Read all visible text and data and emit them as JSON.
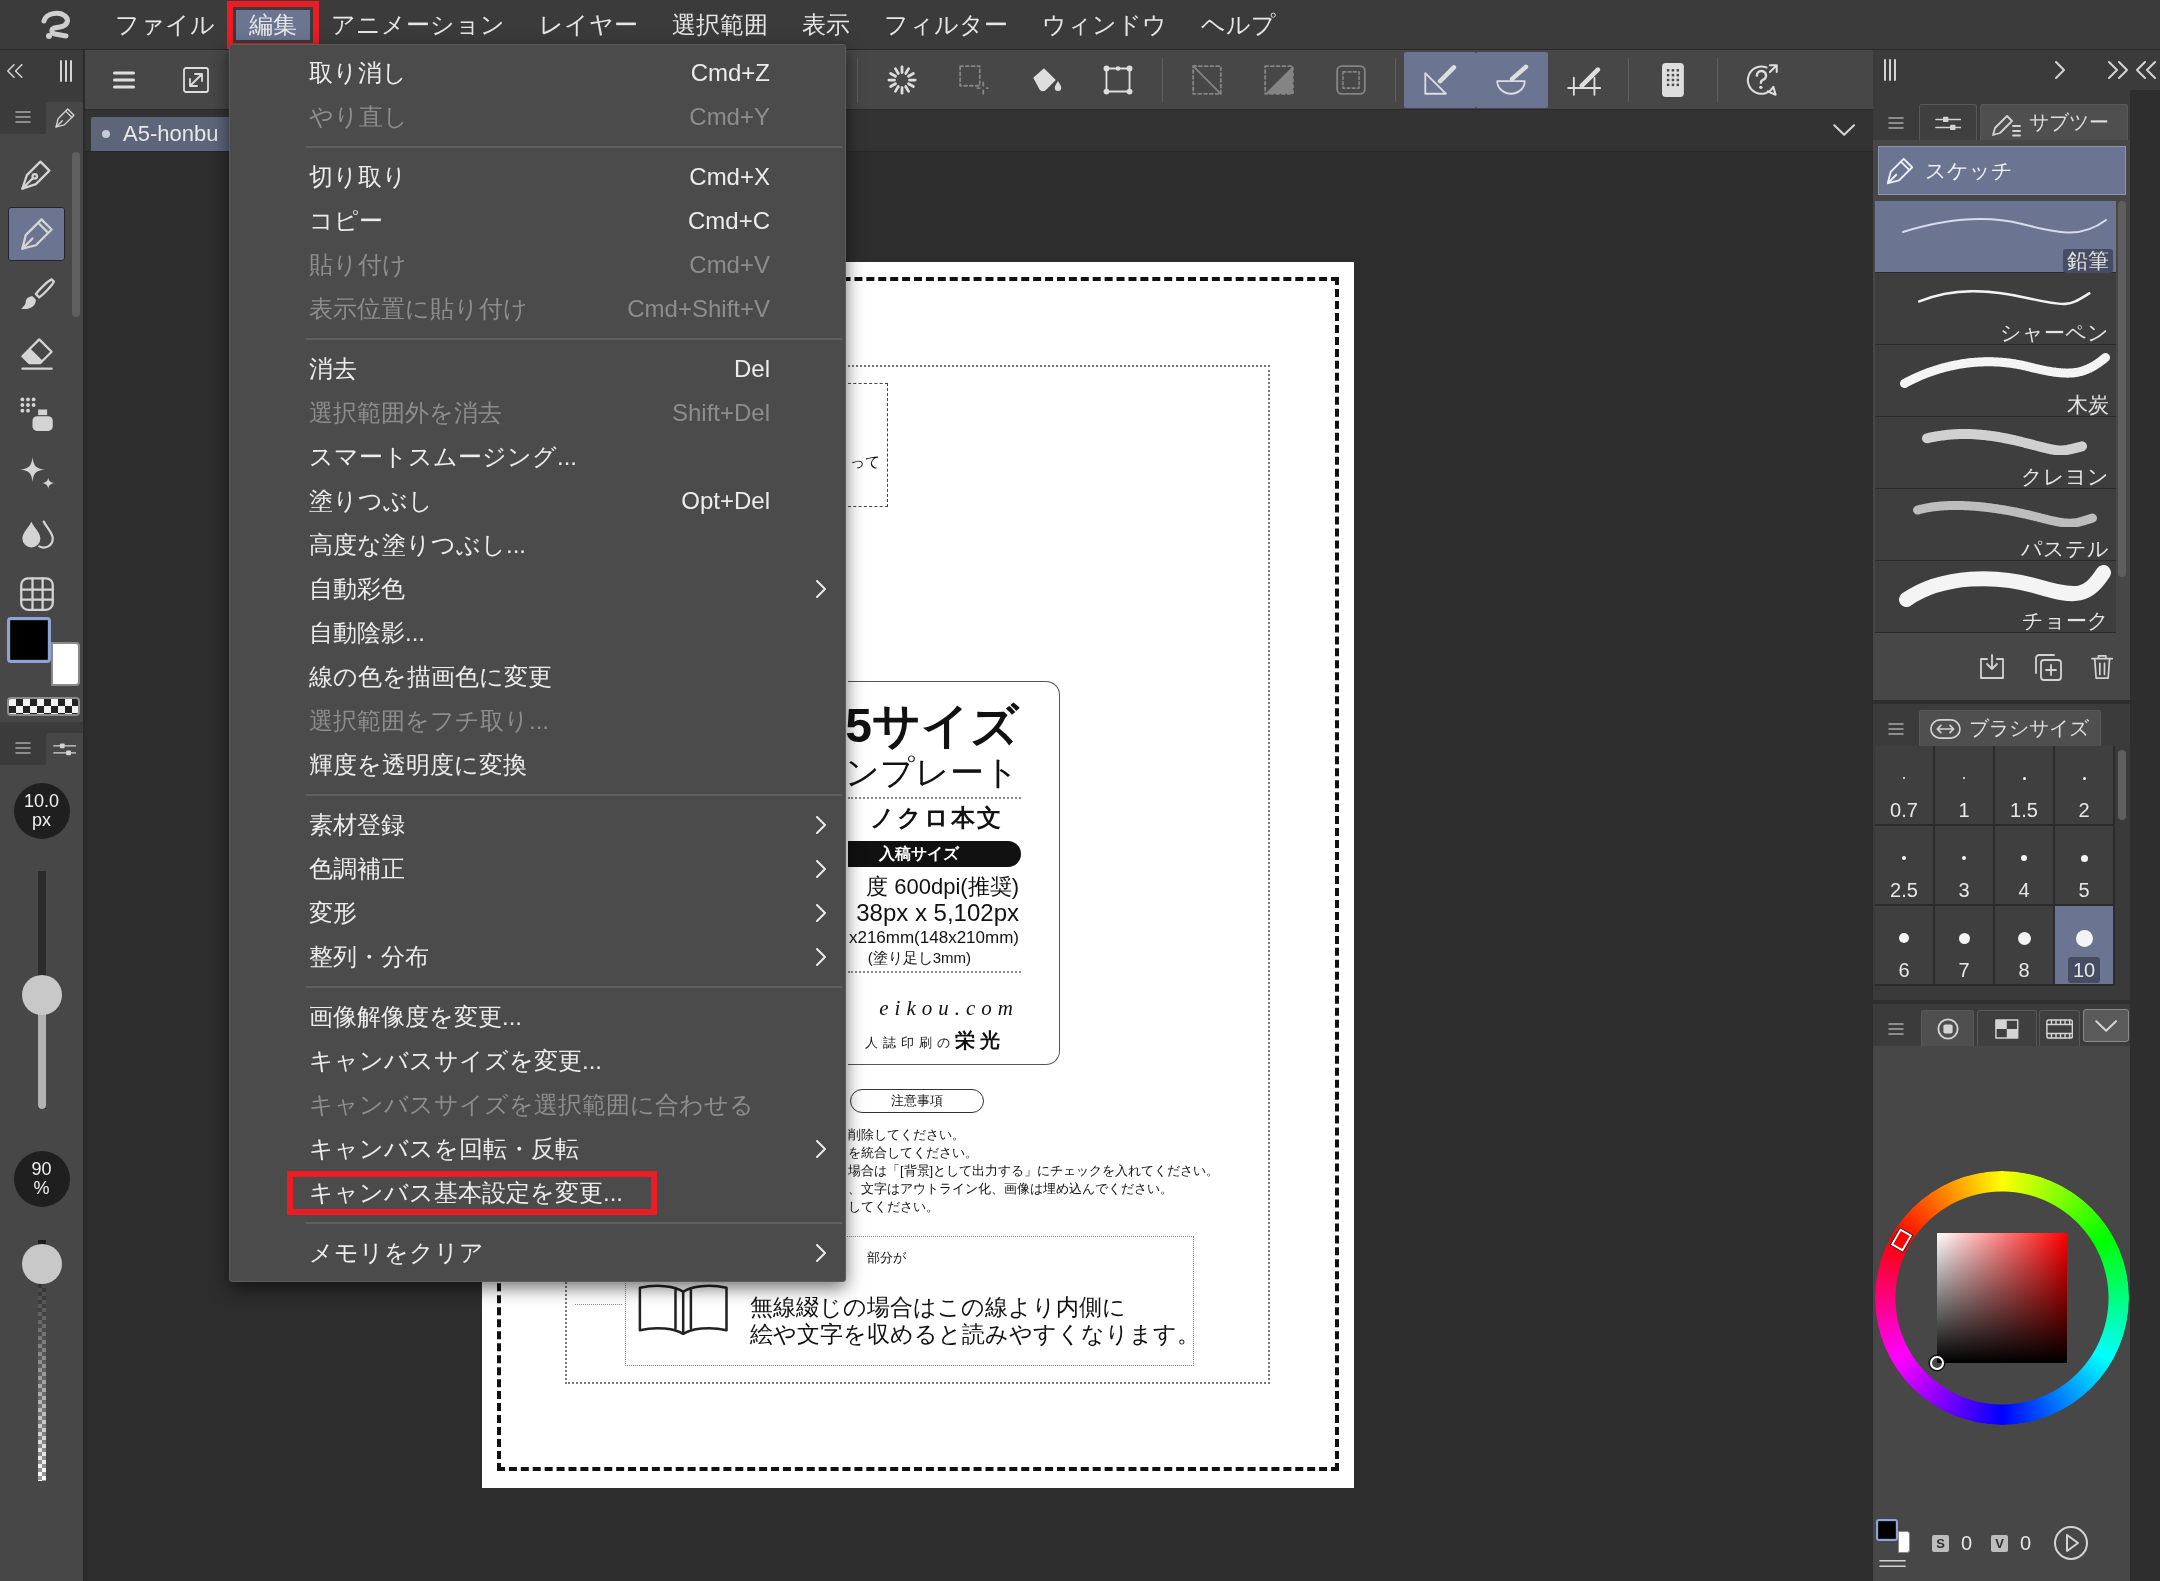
{
  "menu_bar": {
    "items": [
      {
        "label": "ファイル",
        "selected": false,
        "annotated": false
      },
      {
        "label": "編集",
        "selected": true,
        "annotated": true
      },
      {
        "label": "アニメーション",
        "selected": false,
        "annotated": false
      },
      {
        "label": "レイヤー",
        "selected": false,
        "annotated": false
      },
      {
        "label": "選択範囲",
        "selected": false,
        "annotated": false
      },
      {
        "label": "表示",
        "selected": false,
        "annotated": false
      },
      {
        "label": "フィルター",
        "selected": false,
        "annotated": false
      },
      {
        "label": "ウィンドウ",
        "selected": false,
        "annotated": false
      },
      {
        "label": "ヘルプ",
        "selected": false,
        "annotated": false
      }
    ]
  },
  "toolbar": {
    "left_buttons": [
      {
        "selected": false,
        "disabled": false
      },
      {
        "selected": false,
        "disabled": false
      }
    ],
    "groups": [
      [
        {
          "selected": false,
          "disabled": false
        },
        {
          "selected": false,
          "disabled": true
        },
        {
          "selected": false,
          "disabled": false
        },
        {
          "selected": false,
          "disabled": false
        }
      ],
      [
        {
          "selected": false,
          "disabled": true
        },
        {
          "selected": false,
          "disabled": true
        },
        {
          "selected": false,
          "disabled": true
        }
      ],
      [
        {
          "selected": true,
          "disabled": false
        },
        {
          "selected": true,
          "disabled": false
        },
        {
          "selected": false,
          "disabled": false
        }
      ],
      [
        {
          "selected": false,
          "disabled": false
        }
      ],
      [
        {
          "selected": false,
          "disabled": false
        }
      ]
    ]
  },
  "document_tabs": [
    {
      "title": "A5-honbu",
      "selected": true
    }
  ],
  "edit_menu": {
    "groups": [
      {
        "items": [
          {
            "label": "取り消し",
            "shortcut": "Cmd+Z",
            "disabled": false,
            "submenu": false,
            "annotated": false
          },
          {
            "label": "やり直し",
            "shortcut": "Cmd+Y",
            "disabled": true,
            "submenu": false,
            "annotated": false
          }
        ]
      },
      {
        "items": [
          {
            "label": "切り取り",
            "shortcut": "Cmd+X",
            "disabled": false,
            "submenu": false,
            "annotated": false
          },
          {
            "label": "コピー",
            "shortcut": "Cmd+C",
            "disabled": false,
            "submenu": false,
            "annotated": false
          },
          {
            "label": "貼り付け",
            "shortcut": "Cmd+V",
            "disabled": true,
            "submenu": false,
            "annotated": false
          },
          {
            "label": "表示位置に貼り付け",
            "shortcut": "Cmd+Shift+V",
            "disabled": true,
            "submenu": false,
            "annotated": false
          }
        ]
      },
      {
        "items": [
          {
            "label": "消去",
            "shortcut": "Del",
            "disabled": false,
            "submenu": false,
            "annotated": false
          },
          {
            "label": "選択範囲外を消去",
            "shortcut": "Shift+Del",
            "disabled": true,
            "submenu": false,
            "annotated": false
          },
          {
            "label": "スマートスムージング...",
            "disabled": false,
            "submenu": false,
            "annotated": false
          },
          {
            "label": "塗りつぶし",
            "shortcut": "Opt+Del",
            "disabled": false,
            "submenu": false,
            "annotated": false
          },
          {
            "label": "高度な塗りつぶし...",
            "disabled": false,
            "submenu": false,
            "annotated": false
          },
          {
            "label": "自動彩色",
            "disabled": false,
            "submenu": true,
            "annotated": false
          },
          {
            "label": "自動陰影...",
            "disabled": false,
            "submenu": false,
            "annotated": false
          },
          {
            "label": "線の色を描画色に変更",
            "disabled": false,
            "submenu": false,
            "annotated": false
          },
          {
            "label": "選択範囲をフチ取り...",
            "disabled": true,
            "submenu": false,
            "annotated": false
          },
          {
            "label": "輝度を透明度に変換",
            "disabled": false,
            "submenu": false,
            "annotated": false
          }
        ]
      },
      {
        "items": [
          {
            "label": "素材登録",
            "disabled": false,
            "submenu": true,
            "annotated": false
          },
          {
            "label": "色調補正",
            "disabled": false,
            "submenu": true,
            "annotated": false
          },
          {
            "label": "変形",
            "disabled": false,
            "submenu": true,
            "annotated": false
          },
          {
            "label": "整列・分布",
            "disabled": false,
            "submenu": true,
            "annotated": false
          }
        ]
      },
      {
        "items": [
          {
            "label": "画像解像度を変更...",
            "disabled": false,
            "submenu": false,
            "annotated": false
          },
          {
            "label": "キャンバスサイズを変更...",
            "disabled": false,
            "submenu": false,
            "annotated": false
          },
          {
            "label": "キャンバスサイズを選択範囲に合わせる",
            "disabled": true,
            "submenu": false,
            "annotated": false
          },
          {
            "label": "キャンバスを回転・反転",
            "disabled": false,
            "submenu": true,
            "annotated": false
          },
          {
            "label": "キャンバス基本設定を変更...",
            "disabled": false,
            "submenu": false,
            "annotated": true
          }
        ]
      },
      {
        "items": [
          {
            "label": "メモリをクリア",
            "disabled": false,
            "submenu": true,
            "annotated": false
          }
        ]
      }
    ]
  },
  "left_panel": {
    "tools": [
      {
        "selected": false
      },
      {
        "selected": true
      },
      {
        "selected": false
      },
      {
        "selected": false
      },
      {
        "selected": false
      },
      {
        "selected": false
      },
      {
        "selected": false
      },
      {
        "selected": false
      }
    ],
    "color_chips": [
      {
        "color": "#000000",
        "selected": true
      },
      {
        "color": "#ffffff",
        "selected": false
      }
    ],
    "brush_size": {
      "reading": "10.0",
      "unit": "px",
      "level": 0.48
    },
    "opacity": {
      "reading": "90",
      "unit": "%",
      "level": 0.9
    }
  },
  "right_panel": {
    "sub_tool": {
      "tabs": [
        {
          "selected": false
        },
        {
          "label": "サブツー",
          "selected": true
        }
      ],
      "group": "スケッチ",
      "brushes": [
        {
          "name": "鉛筆",
          "kind": "thin",
          "selected": true
        },
        {
          "name": "シャーペン",
          "kind": "fine",
          "selected": false
        },
        {
          "name": "木炭",
          "kind": "rough",
          "selected": false
        },
        {
          "name": "クレヨン",
          "kind": "grainy",
          "selected": false
        },
        {
          "name": "パステル",
          "kind": "dusty",
          "selected": false
        },
        {
          "name": "チョーク",
          "kind": "broad",
          "selected": false
        }
      ]
    },
    "brush_size": {
      "tab": "ブラシサイズ",
      "sizes": [
        {
          "label": "0.7",
          "selected": false
        },
        {
          "label": "1",
          "selected": false
        },
        {
          "label": "1.5",
          "selected": false
        },
        {
          "label": "2",
          "selected": false
        },
        {
          "label": "2.5",
          "selected": false
        },
        {
          "label": "3",
          "selected": false
        },
        {
          "label": "4",
          "selected": false
        },
        {
          "label": "5",
          "selected": false
        },
        {
          "label": "6",
          "selected": false
        },
        {
          "label": "7",
          "selected": false
        },
        {
          "label": "8",
          "selected": false
        },
        {
          "label": "10",
          "selected": true
        }
      ]
    },
    "color": {
      "tabs": [
        {
          "selected": true
        },
        {
          "selected": false
        },
        {
          "selected": false
        }
      ],
      "color_chips": [
        {
          "color": "#000000",
          "selected": true
        },
        {
          "color": "#ffffff",
          "selected": false
        }
      ],
      "readings": [
        {
          "label": "S",
          "value": "0"
        },
        {
          "label": "V",
          "value": "0"
        }
      ]
    }
  },
  "document": {
    "corner_note": "って",
    "card": {
      "title": "5サイズ",
      "subtitle": "ンプレート",
      "category": "ノクロ本文",
      "badge": "入稿サイズ",
      "specs": [
        "度 600dpi(推奨)",
        "38px x 5,102px",
        "x216mm(148x210mm)",
        "(塗り足し3mm)"
      ],
      "site": "eikou.com",
      "company": "人誌印刷の**栄光**"
    },
    "notice_heading": "注意事項",
    "notices": [
      "削除してください。",
      "を統合してください。",
      "場合は「[背景]として出力する」にチェックを入れてください。",
      "、文字はアウトライン化、画像は埋め込んでください。",
      "してください。"
    ],
    "binding": {
      "caption": "部分が",
      "lines": [
        "無線綴じの場合はこの線より内側に",
        "絵や文字を収めると読みやすくなります。"
      ]
    }
  }
}
